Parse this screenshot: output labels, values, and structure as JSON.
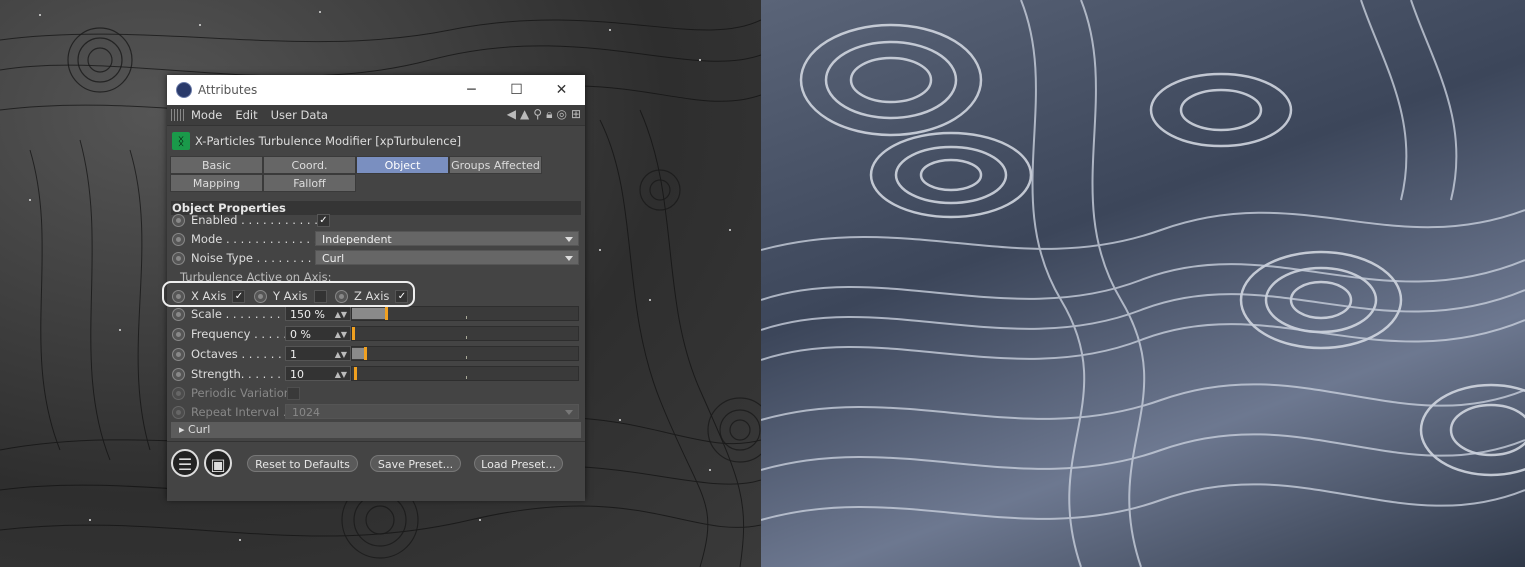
{
  "window": {
    "title": "Attributes",
    "minimize_glyph": "─",
    "maximize_glyph": "☐",
    "close_glyph": "✕"
  },
  "menu": {
    "items": [
      "Mode",
      "Edit",
      "User Data"
    ]
  },
  "object": {
    "name": "X-Particles Turbulence Modifier [xpTurbulence]"
  },
  "tabs": {
    "row1": [
      "Basic",
      "Coord.",
      "Object",
      "Groups Affected"
    ],
    "row2": [
      "Mapping",
      "Falloff"
    ],
    "active": "Object"
  },
  "section": {
    "title": "Object Properties"
  },
  "props": {
    "enabled": {
      "label": "Enabled . . . . . . . . . . . . . .",
      "checked": true
    },
    "mode": {
      "label": "Mode . . . . . . . . . . . . . . .",
      "value": "Independent"
    },
    "noise_type": {
      "label": "Noise Type . . . . . . . . . . .",
      "value": "Curl"
    },
    "turb_axis_label": "Turbulence Active on Axis:",
    "x_axis": {
      "label": "X Axis",
      "checked": true
    },
    "y_axis": {
      "label": "Y Axis",
      "checked": false
    },
    "z_axis": {
      "label": "Z Axis",
      "checked": true
    },
    "scale": {
      "label": "Scale . . . . . . . . . . .",
      "value": "150 %",
      "level": 0.1
    },
    "frequency": {
      "label": "Frequency . . . . . .",
      "value": "0 %",
      "level": 0.0
    },
    "octaves": {
      "label": "Octaves . . . . . . . .",
      "value": "1",
      "level": 0.05
    },
    "strength": {
      "label": "Strength. . . . . . . .",
      "value": "10",
      "level": 0.01
    },
    "periodic_variation": {
      "label": "Periodic Variation",
      "checked": false
    },
    "repeat_interval": {
      "label": "Repeat Interval . .",
      "value": "1024"
    }
  },
  "curl_group": {
    "label": "Curl"
  },
  "buttons": {
    "reset": "Reset to Defaults",
    "save": "Save Preset...",
    "load": "Load Preset..."
  },
  "colors": {
    "accent_tab": "#7a8fc0",
    "slider_knob": "#f0a020"
  }
}
